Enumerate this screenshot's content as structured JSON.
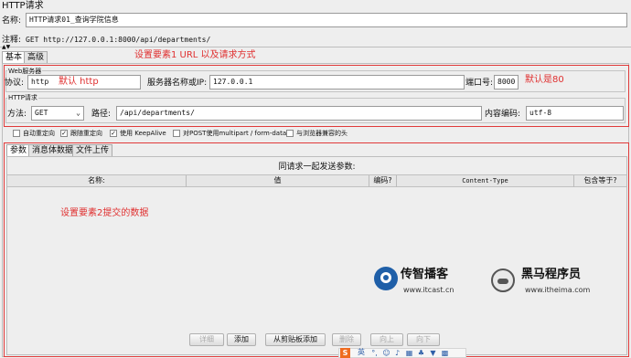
{
  "panel": {
    "title": "HTTP请求"
  },
  "name_field": {
    "label": "名称:",
    "value": "HTTP请求01_查询学院信息"
  },
  "comment_field": {
    "label": "注释:",
    "value": "GET http://127.0.0.1:8000/api/departments/"
  },
  "tabs": [
    {
      "label": "基本"
    },
    {
      "label": "高级"
    }
  ],
  "annotations": {
    "element1": "设置要素1 URL 以及请求方式",
    "default_http": "默认 http",
    "default_80": "默认是80",
    "element2": "设置要素2提交的数据"
  },
  "web_server": {
    "legend": "Web服务器",
    "protocol_label": "协议:",
    "protocol_value": "http",
    "server_label": "服务器名称或IP:",
    "server_value": "127.0.0.1",
    "port_label": "端口号:",
    "port_value": "8000"
  },
  "http_request": {
    "legend": "HTTP请求",
    "method_label": "方法:",
    "method_value": "GET",
    "path_label": "路径:",
    "path_value": "/api/departments/",
    "encoding_label": "内容编码:",
    "encoding_value": "utf-8"
  },
  "checkboxes": [
    {
      "label": "自动重定向",
      "checked": false
    },
    {
      "label": "跟随重定向",
      "checked": true
    },
    {
      "label": "使用 KeepAlive",
      "checked": true
    },
    {
      "label": "对POST使用multipart / form-data",
      "checked": false
    },
    {
      "label": "与浏览器兼容的头",
      "checked": false
    }
  ],
  "param_tabs": [
    {
      "label": "参数"
    },
    {
      "label": "消息体数据"
    },
    {
      "label": "文件上传"
    }
  ],
  "params_table": {
    "caption": "同请求一起发送参数:",
    "columns": [
      "名称:",
      "值",
      "编码?",
      "Content-Type",
      "包含等于?"
    ]
  },
  "buttons": [
    {
      "label": "详细",
      "enabled": false
    },
    {
      "label": "添加",
      "enabled": true
    },
    {
      "label": "从剪贴板添加",
      "enabled": true
    },
    {
      "label": "删除",
      "enabled": false
    },
    {
      "label": "向上",
      "enabled": false
    },
    {
      "label": "向下",
      "enabled": false
    }
  ],
  "watermarks": {
    "itcast_name": "传智播客",
    "itcast_url": "www.itcast.cn",
    "itheima_name": "黑马程序员",
    "itheima_url": "www.itheima.com"
  },
  "ime_toolbar": {
    "mode_label": "英"
  },
  "colors": {
    "annotation_red": "#e03a3a",
    "itcast_blue": "#1f5fa8"
  }
}
